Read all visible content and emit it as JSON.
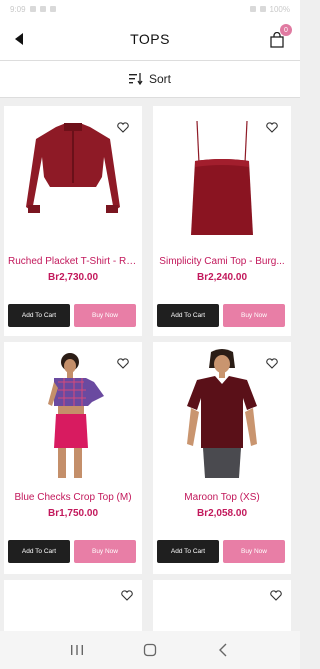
{
  "status_bar": {
    "time": "9:09",
    "battery": "100%"
  },
  "header": {
    "title": "TOPS",
    "cart_count": "0"
  },
  "sort": {
    "label": "Sort"
  },
  "products": [
    {
      "name": "Ruched Placket T-Shirt - Re...",
      "price": "Br2,730.00",
      "add_label": "Add To Cart",
      "buy_label": "Buy Now",
      "image": "red-blouse"
    },
    {
      "name": "Simplicity Cami Top - Burg...",
      "price": "Br2,240.00",
      "add_label": "Add To Cart",
      "buy_label": "Buy Now",
      "image": "burgundy-cami"
    },
    {
      "name": "Blue Checks Crop Top (M)",
      "price": "Br1,750.00",
      "add_label": "Add To Cart",
      "buy_label": "Buy Now",
      "image": "checks-crop-top"
    },
    {
      "name": "Maroon Top (XS)",
      "price": "Br2,058.00",
      "add_label": "Add To Cart",
      "buy_label": "Buy Now",
      "image": "maroon-tshirt"
    }
  ],
  "colors": {
    "accent": "#c2185b",
    "buy_button": "#e87ea6",
    "cart_button": "#1f1f1f"
  }
}
